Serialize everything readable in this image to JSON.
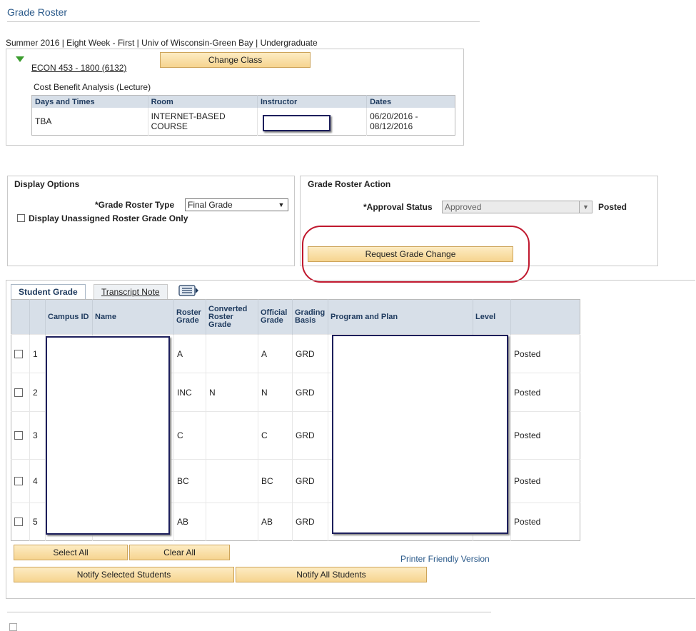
{
  "page_title": "Grade Roster",
  "term_info": "Summer 2016 | Eight Week - First | Univ of Wisconsin-Green Bay | Undergraduate",
  "class": {
    "link": "ECON 453 - 1800 (6132)",
    "change_button": "Change Class",
    "description": "Cost Benefit Analysis (Lecture)",
    "headers": {
      "days": "Days and Times",
      "room": "Room",
      "instructor": "Instructor",
      "dates": "Dates"
    },
    "row": {
      "days": "TBA",
      "room_line1": "INTERNET-BASED",
      "room_line2": "COURSE",
      "instructor": "",
      "dates_line1": "06/20/2016 -",
      "dates_line2": "08/12/2016"
    }
  },
  "display_options": {
    "title": "Display Options",
    "roster_type_label": "*Grade Roster Type",
    "roster_type_value": "Final Grade",
    "unassigned_label": "Display Unassigned Roster Grade Only"
  },
  "roster_action": {
    "title": "Grade Roster Action",
    "approval_label": "*Approval Status",
    "approval_value": "Approved",
    "status": "Posted",
    "request_button": "Request Grade Change"
  },
  "tabs": {
    "student_grade": "Student Grade",
    "transcript_note": "Transcript Note"
  },
  "roster": {
    "headers": {
      "campus_id": "Campus ID",
      "name": "Name",
      "roster_grade": [
        "Roster",
        "Grade"
      ],
      "converted": [
        "Converted",
        "Roster",
        "Grade"
      ],
      "official": [
        "Official",
        "Grade"
      ],
      "grading_basis": [
        "Grading",
        "Basis"
      ],
      "program": "Program and Plan",
      "level": "Level"
    },
    "rows": [
      {
        "num": "1",
        "roster_grade": "A",
        "converted": "",
        "official": "A",
        "basis": "GRD",
        "status": "Posted"
      },
      {
        "num": "2",
        "roster_grade": "INC",
        "converted": "N",
        "official": "N",
        "basis": "GRD",
        "status": "Posted"
      },
      {
        "num": "3",
        "roster_grade": "C",
        "converted": "",
        "official": "C",
        "basis": "GRD",
        "status": "Posted"
      },
      {
        "num": "4",
        "roster_grade": "BC",
        "converted": "",
        "official": "BC",
        "basis": "GRD",
        "status": "Posted"
      },
      {
        "num": "5",
        "roster_grade": "AB",
        "converted": "",
        "official": "AB",
        "basis": "GRD",
        "status": "Posted"
      }
    ]
  },
  "actions": {
    "select_all": "Select All",
    "clear_all": "Clear All",
    "notify_selected": "Notify Selected Students",
    "notify_all": "Notify All Students",
    "printer_friendly": "Printer Friendly Version"
  },
  "colors": {
    "title_blue": "#2b5a8a",
    "header_bg": "#d7dfe8",
    "annotation_red": "#c0182e",
    "redaction_navy": "#1d1f5c",
    "button_bg": "#f6d48f"
  }
}
